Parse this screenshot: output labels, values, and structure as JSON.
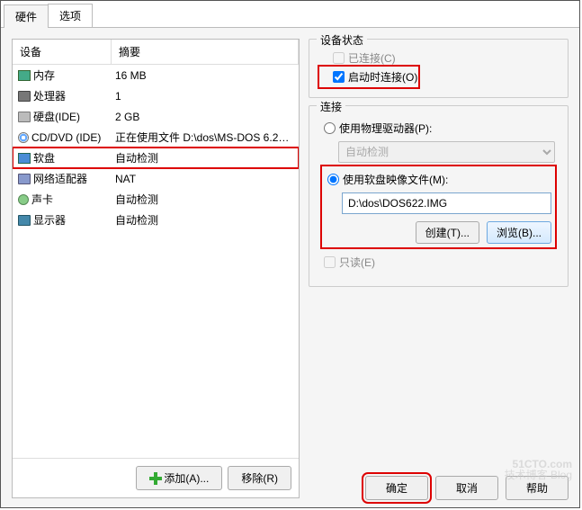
{
  "tabs": {
    "hardware": "硬件",
    "options": "选项"
  },
  "columns": {
    "device": "设备",
    "summary": "摘要"
  },
  "devices": [
    {
      "icon": "mem",
      "name": "内存",
      "summary": "16 MB"
    },
    {
      "icon": "cpu",
      "name": "处理器",
      "summary": "1"
    },
    {
      "icon": "hdd",
      "name": "硬盘(IDE)",
      "summary": "2 GB"
    },
    {
      "icon": "cd",
      "name": "CD/DVD (IDE)",
      "summary": "正在使用文件 D:\\dos\\MS-DOS 6.22...."
    },
    {
      "icon": "floppy",
      "name": "软盘",
      "summary": "自动检测",
      "selected": true
    },
    {
      "icon": "net",
      "name": "网络适配器",
      "summary": "NAT"
    },
    {
      "icon": "snd",
      "name": "声卡",
      "summary": "自动检测"
    },
    {
      "icon": "disp",
      "name": "显示器",
      "summary": "自动检测"
    }
  ],
  "buttons": {
    "add": "添加(A)...",
    "remove": "移除(R)",
    "ok": "确定",
    "cancel": "取消",
    "help": "帮助",
    "create": "创建(T)...",
    "browse": "浏览(B)..."
  },
  "status": {
    "title": "设备状态",
    "connected": "已连接(C)",
    "connect_on": "启动时连接(O)"
  },
  "connection": {
    "title": "连接",
    "use_physical": "使用物理驱动器(P):",
    "auto_detect": "自动检测",
    "use_image": "使用软盘映像文件(M):",
    "image_path": "D:\\dos\\DOS622.IMG",
    "readonly": "只读(E)"
  },
  "watermark": {
    "big": "51CTO.com",
    "small": "技术博客  Blog"
  }
}
